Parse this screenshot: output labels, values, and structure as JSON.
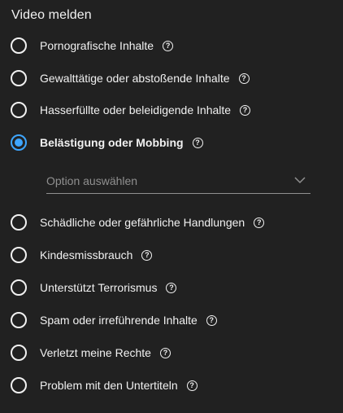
{
  "dialog": {
    "title": "Video melden"
  },
  "options": [
    {
      "label": "Pornografische Inhalte",
      "checked": false,
      "help_icon": "help-circle-icon",
      "help_glyph": "?"
    },
    {
      "label": "Gewalttätige oder abstoßende Inhalte",
      "checked": false,
      "help_icon": "help-circle-icon",
      "help_glyph": "?"
    },
    {
      "label": "Hasserfüllte oder beleidigende Inhalte",
      "checked": false,
      "help_icon": "help-circle-icon",
      "help_glyph": "?"
    },
    {
      "label": "Belästigung oder Mobbing",
      "checked": true,
      "help_icon": "help-circle-icon",
      "help_glyph": "?"
    },
    {
      "label": "Schädliche oder gefährliche Handlungen",
      "checked": false,
      "help_icon": "help-circle-icon",
      "help_glyph": "?"
    },
    {
      "label": "Kindesmissbrauch",
      "checked": false,
      "help_icon": "help-circle-icon",
      "help_glyph": "?"
    },
    {
      "label": "Unterstützt Terrorismus",
      "checked": false,
      "help_icon": "help-circle-icon",
      "help_glyph": "?"
    },
    {
      "label": "Spam oder irreführende Inhalte",
      "checked": false,
      "help_icon": "help-circle-icon",
      "help_glyph": "?"
    },
    {
      "label": "Verletzt meine Rechte",
      "checked": false,
      "help_icon": "help-circle-icon",
      "help_glyph": "?"
    },
    {
      "label": "Problem mit den Untertiteln",
      "checked": false,
      "help_icon": "help-circle-icon",
      "help_glyph": "?"
    }
  ],
  "suboption_dropdown": {
    "placeholder": "Option auswählen",
    "icon": "chevron-down-icon"
  },
  "colors": {
    "background": "#212121",
    "text": "#f1f1f1",
    "accent": "#3ea6ff",
    "muted": "#909090"
  }
}
